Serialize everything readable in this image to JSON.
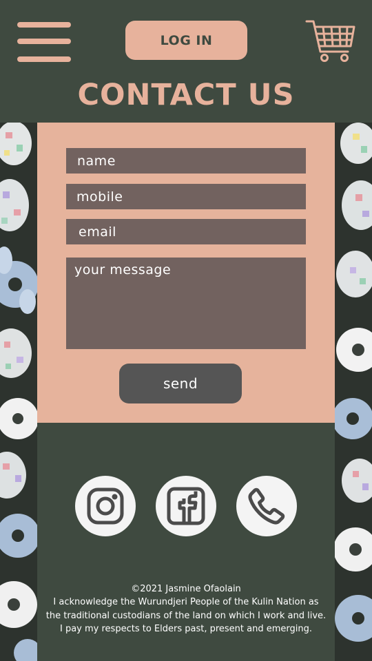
{
  "header": {
    "menu_icon": "hamburger-menu-icon",
    "login_label": "LOG IN",
    "cart_icon": "shopping-cart-icon",
    "title": "CONTACT US"
  },
  "form": {
    "fields": [
      {
        "label": "name"
      },
      {
        "label": "mobile"
      },
      {
        "label": "email"
      },
      {
        "label": "your message"
      }
    ],
    "send_label": "send"
  },
  "footer": {
    "social": [
      {
        "icon": "instagram-icon"
      },
      {
        "icon": "facebook-icon"
      },
      {
        "icon": "phone-icon"
      }
    ],
    "copyright": "©2021 Jasmine Ofaolain",
    "acknowledgement": "I acknowledge the Wurundjeri People of the Kulin Nation as the traditional custodians of the land on which I work and live. I pay my respects to Elders past, present and emerging."
  },
  "colors": {
    "header_bg": "#3f4a40",
    "accent_peach": "#e7b29c",
    "field_bg": "#72625f",
    "send_bg": "#555555",
    "icon_circle": "#f4f4f4"
  }
}
